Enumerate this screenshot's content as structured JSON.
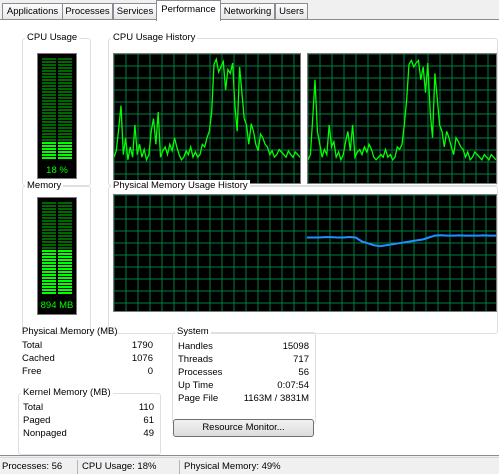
{
  "tabs": [
    {
      "label": "Applications"
    },
    {
      "label": "Processes"
    },
    {
      "label": "Services"
    },
    {
      "label": "Performance"
    },
    {
      "label": "Networking"
    },
    {
      "label": "Users"
    }
  ],
  "active_tab": "Performance",
  "cpu_usage": {
    "title": "CPU Usage",
    "label": "18 %",
    "value_percent": 18
  },
  "cpu_history": {
    "title": "CPU Usage History",
    "core0": [
      20,
      25,
      42,
      60,
      22,
      35,
      18,
      28,
      20,
      45,
      22,
      30,
      20,
      26,
      18,
      22,
      40,
      50,
      30,
      55,
      20,
      25,
      28,
      22,
      30,
      25,
      35,
      28,
      22,
      18,
      20,
      25,
      22,
      28,
      20,
      24,
      20,
      22,
      30,
      28,
      35,
      40,
      55,
      92,
      96,
      86,
      90,
      94,
      72,
      88,
      85,
      93,
      60,
      40,
      90,
      70,
      50,
      45,
      30,
      46,
      40,
      30,
      25,
      38,
      35,
      30,
      28,
      22,
      25,
      20,
      22,
      26,
      24,
      22,
      20,
      25,
      22,
      20,
      24,
      22,
      20
    ],
    "core1": [
      18,
      22,
      50,
      80,
      40,
      30,
      20,
      26,
      22,
      45,
      28,
      32,
      20,
      24,
      18,
      22,
      32,
      40,
      25,
      45,
      20,
      24,
      26,
      22,
      28,
      24,
      30,
      26,
      20,
      18,
      20,
      22,
      20,
      26,
      20,
      22,
      18,
      20,
      28,
      26,
      30,
      45,
      65,
      92,
      95,
      90,
      93,
      95,
      80,
      90,
      70,
      93,
      55,
      35,
      85,
      65,
      45,
      40,
      28,
      40,
      35,
      28,
      22,
      35,
      32,
      28,
      26,
      20,
      24,
      18,
      20,
      24,
      22,
      20,
      18,
      22,
      20,
      18,
      22,
      20,
      18
    ]
  },
  "memory": {
    "title": "Memory",
    "label": "894 MB",
    "fraction": 0.49
  },
  "memory_history": {
    "title": "Physical Memory Usage History",
    "values": [
      38,
      38,
      38,
      38.2,
      38.2,
      38,
      38,
      38.3,
      38,
      36,
      35,
      34,
      33.5,
      34,
      34.5,
      35,
      35.5,
      36,
      36.5,
      37,
      38,
      39,
      39.2,
      39,
      39,
      39.1,
      39,
      39,
      39,
      39.1,
      39,
      39
    ]
  },
  "physical_memory": {
    "title": "Physical Memory (MB)",
    "rows": [
      {
        "k": "Total",
        "v": "1790"
      },
      {
        "k": "Cached",
        "v": "1076"
      },
      {
        "k": "Free",
        "v": "0"
      }
    ]
  },
  "kernel_memory": {
    "title": "Kernel Memory (MB)",
    "rows": [
      {
        "k": "Total",
        "v": "110"
      },
      {
        "k": "Paged",
        "v": "61"
      },
      {
        "k": "Nonpaged",
        "v": "49"
      }
    ]
  },
  "system": {
    "title": "System",
    "rows": [
      {
        "k": "Handles",
        "v": "15098"
      },
      {
        "k": "Threads",
        "v": "717"
      },
      {
        "k": "Processes",
        "v": "56"
      },
      {
        "k": "Up Time",
        "v": "0:07:54"
      },
      {
        "k": "Page File",
        "v": "1163M / 3831M"
      }
    ]
  },
  "resource_monitor_button": "Resource Monitor...",
  "statusbar": {
    "processes": "Processes: 56",
    "cpu": "CPU Usage: 18%",
    "memory": "Physical Memory: 49%"
  },
  "colors": {
    "graph_line": "#00ff00",
    "graph_grid": "#008040",
    "memory_line": "#1e90ff",
    "meter_lit": "#00ff00",
    "meter_dim": "#006600"
  }
}
